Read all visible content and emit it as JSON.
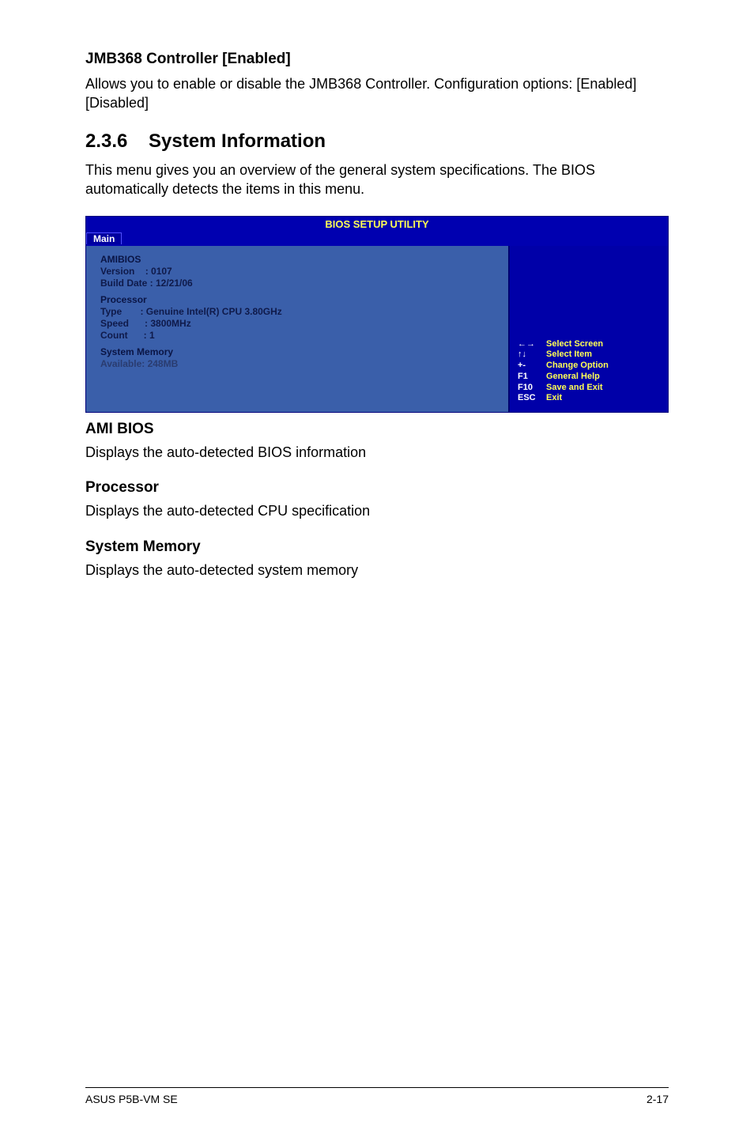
{
  "sec1": {
    "title": "JMB368 Controller [Enabled]",
    "body": "Allows you to enable or disable the JMB368 Controller. Configuration options: [Enabled] [Disabled]"
  },
  "sec2": {
    "num": "2.3.6",
    "title": "System Information",
    "body": "This menu gives you an overview of the general system specifications. The BIOS automatically detects the items in this menu."
  },
  "bios": {
    "title": "BIOS SETUP UTILITY",
    "tab": "Main",
    "left": {
      "h1": "AMIBIOS",
      "l1": "Version    : 0107",
      "l2": "Build Date : 12/21/06",
      "h2": "Processor",
      "l3": "Type       : Genuine Intel(R) CPU 3.80GHz",
      "l4": "Speed      : 3800MHz",
      "l5": "Count      : 1",
      "h3": "System Memory",
      "l6": "Available: 248MB"
    },
    "legend": [
      {
        "key": "←→",
        "desc": "Select Screen"
      },
      {
        "key": "↑↓",
        "desc": "Select Item"
      },
      {
        "key": "+-",
        "desc": "Change Option"
      },
      {
        "key": "F1",
        "desc": "General Help"
      },
      {
        "key": "F10",
        "desc": "Save and Exit"
      },
      {
        "key": "ESC",
        "desc": "Exit"
      }
    ]
  },
  "sec3": {
    "title": "AMI BIOS",
    "body": "Displays the auto-detected BIOS information"
  },
  "sec4": {
    "title": "Processor",
    "body": "Displays the auto-detected CPU specification"
  },
  "sec5": {
    "title": "System Memory",
    "body": "Displays the auto-detected system memory"
  },
  "footer": {
    "left": "ASUS P5B-VM SE",
    "right": "2-17"
  }
}
